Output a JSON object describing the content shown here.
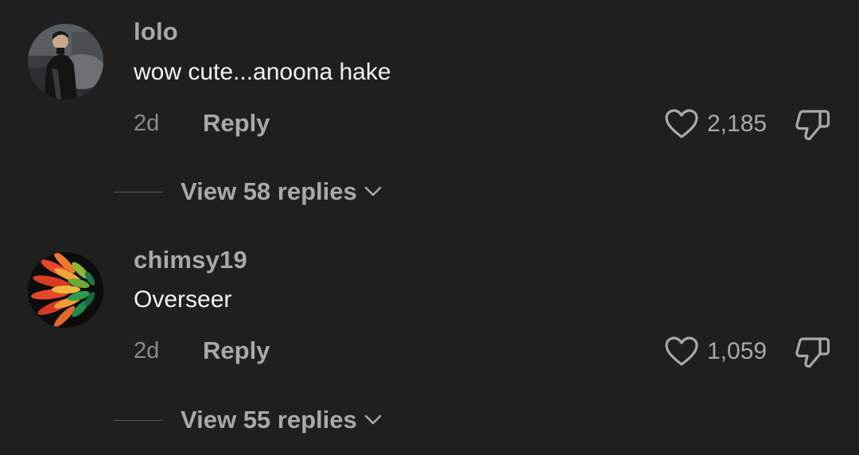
{
  "comments": [
    {
      "username": "lolo",
      "text": "wow cute...anoona hake",
      "time": "2d",
      "reply_label": "Reply",
      "likes": "2,185",
      "view_replies": "View 58 replies",
      "avatar_icon": "photo-person-avatar"
    },
    {
      "username": "chimsy19",
      "text": "Overseer",
      "time": "2d",
      "reply_label": "Reply",
      "likes": "1,059",
      "view_replies": "View 55 replies",
      "avatar_icon": "colorful-flower-avatar"
    }
  ],
  "colors": {
    "background": "#1f1f1f",
    "secondary_text": "#a9a9a9",
    "primary_text": "#f2f2f2",
    "muted_text": "#8a8a8a"
  }
}
